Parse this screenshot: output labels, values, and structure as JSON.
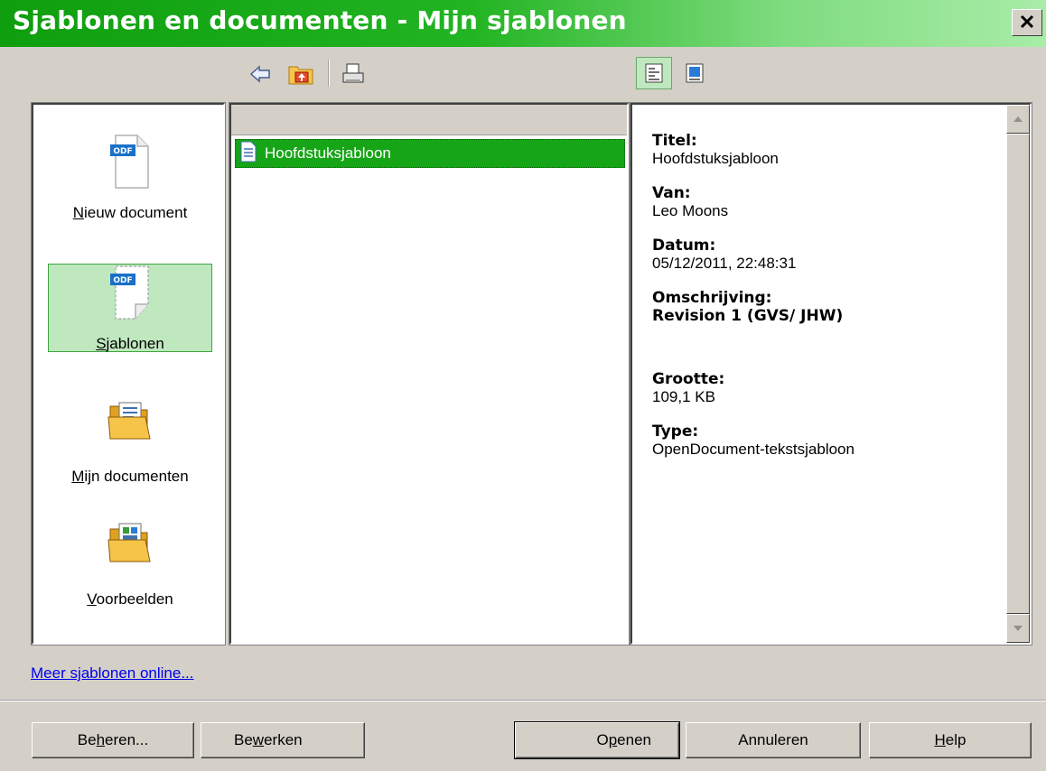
{
  "window": {
    "title": "Sjablonen en documenten - Mijn sjablonen",
    "close_glyph": "✕"
  },
  "toolbar": {
    "icons": [
      "back-icon",
      "up-folder-icon",
      "print-icon",
      "document-preview-icon",
      "document-properties-icon"
    ]
  },
  "categories": [
    {
      "label": "Nieuw document",
      "mnemonic": "N",
      "rest": "ieuw document",
      "icon": "odf-new-document-icon",
      "active": false
    },
    {
      "label": "Sjablonen",
      "mnemonic": "S",
      "rest": "jablonen",
      "icon": "odf-template-icon",
      "active": true
    },
    {
      "label": "Mijn documenten",
      "mnemonic": "M",
      "rest_mid": "ijn documenten",
      "icon": "folder-documents-icon",
      "active": false
    },
    {
      "label": "Voorbeelden",
      "mnemonic": "V",
      "rest": "oorbeelden",
      "icon": "folder-examples-icon",
      "active": false
    }
  ],
  "file_list": {
    "items": [
      {
        "name": "Hoofdstuksjabloon",
        "selected": true
      }
    ]
  },
  "properties": {
    "title_label": "Titel:",
    "title_value": "Hoofdstuksjabloon",
    "from_label": "Van:",
    "from_value": "Leo Moons",
    "date_label": "Datum:",
    "date_value": "05/12/2011, 22:48:31",
    "description_label": "Omschrijving:",
    "description_value": "Revision 1 (GVS/ JHW)",
    "size_label": "Grootte:",
    "size_value": "109,1 KB",
    "type_label": "Type:",
    "type_value": "OpenDocument-tekstsjabloon"
  },
  "link": {
    "label": "Meer sjablonen online..."
  },
  "buttons": {
    "manage": {
      "pre": "Be",
      "mn": "h",
      "post": "eren..."
    },
    "edit": {
      "pre": "Be",
      "mn": "w",
      "post": "erken"
    },
    "open": {
      "pre": "O",
      "mn": "p",
      "post": "enen"
    },
    "cancel": {
      "label": "Annuleren"
    },
    "help": {
      "pre": "",
      "mn": "H",
      "post": "elp"
    }
  },
  "colors": {
    "title_gradient_start": "#0e9e0e",
    "title_gradient_end": "#a8eca8",
    "selection": "#16a516",
    "active_category": "#bfe8bf",
    "link": "#0000ee"
  }
}
